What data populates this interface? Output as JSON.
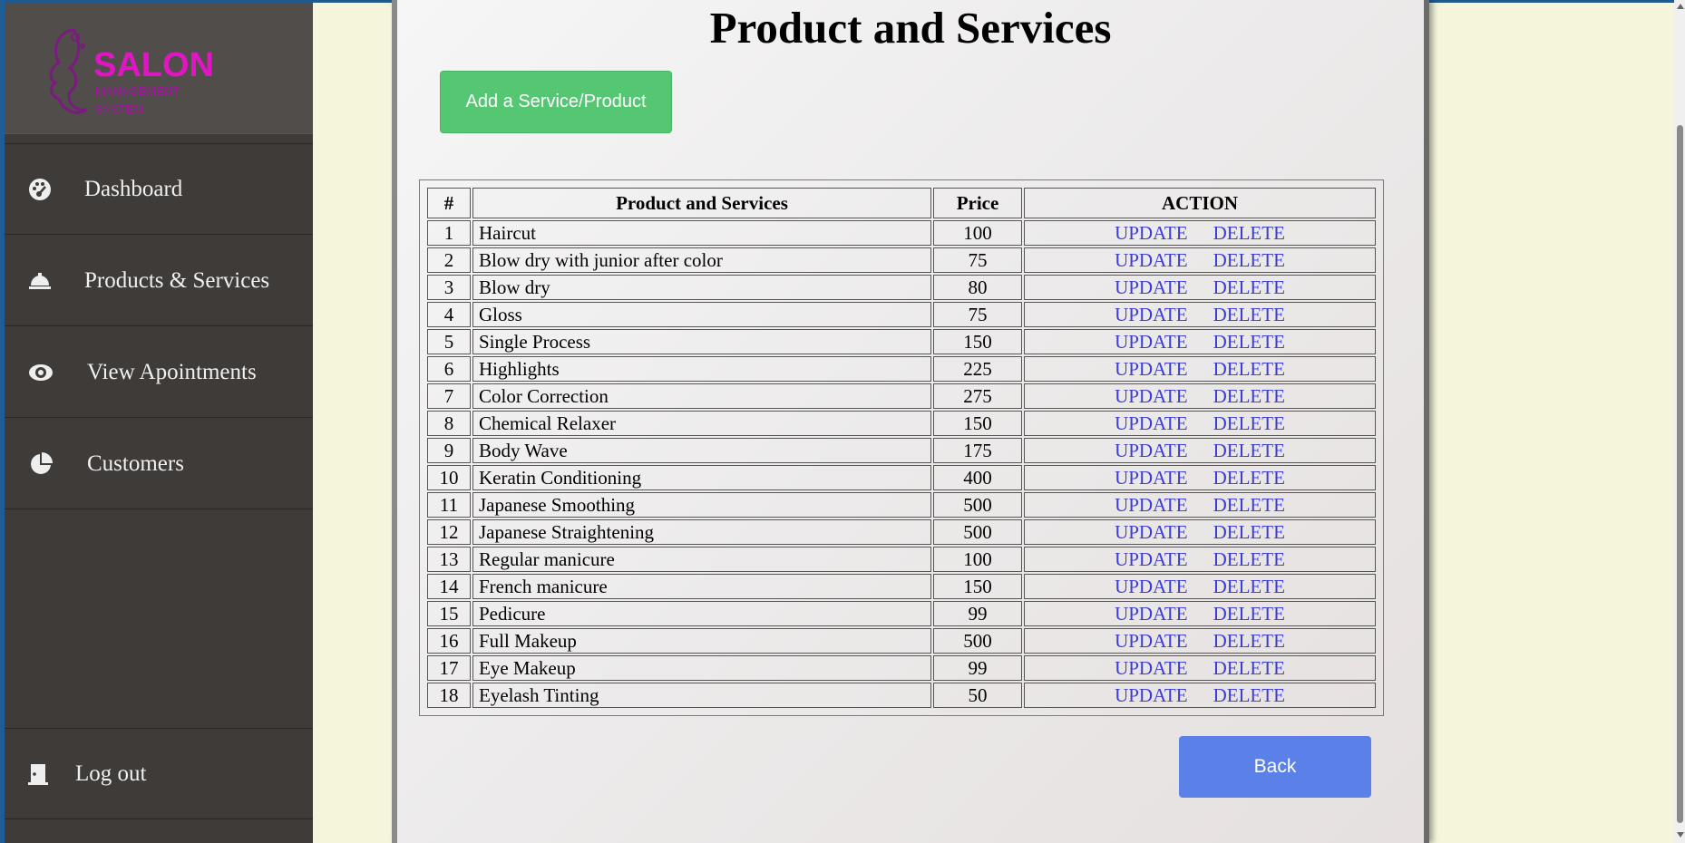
{
  "sidebar": {
    "logo": {
      "title": "SALON",
      "line1": "MANAGEMENT",
      "line2": "SYSTEM"
    },
    "items": [
      {
        "label": "Dashboard",
        "icon": "dashboard-icon"
      },
      {
        "label": "Products & Services",
        "icon": "bell-icon"
      },
      {
        "label": "View Apointments",
        "icon": "eye-icon"
      },
      {
        "label": "Customers",
        "icon": "pie-chart-icon"
      }
    ],
    "logout": {
      "label": "Log out",
      "icon": "door-icon"
    }
  },
  "main": {
    "title": "Product and Services",
    "add_button": "Add a Service/Product",
    "back_button": "Back",
    "table": {
      "headers": [
        "#",
        "Product and Services",
        "Price",
        "ACTION"
      ],
      "update_label": "UPDATE",
      "delete_label": "DELETE",
      "rows": [
        {
          "id": "1",
          "name": "Haircut",
          "price": "100"
        },
        {
          "id": "2",
          "name": "Blow dry with junior after color",
          "price": "75"
        },
        {
          "id": "3",
          "name": "Blow dry",
          "price": "80"
        },
        {
          "id": "4",
          "name": "Gloss",
          "price": "75"
        },
        {
          "id": "5",
          "name": "Single Process",
          "price": "150"
        },
        {
          "id": "6",
          "name": "Highlights",
          "price": "225"
        },
        {
          "id": "7",
          "name": "Color Correction",
          "price": "275"
        },
        {
          "id": "8",
          "name": "Chemical Relaxer",
          "price": "150"
        },
        {
          "id": "9",
          "name": "Body Wave",
          "price": "175"
        },
        {
          "id": "10",
          "name": "Keratin Conditioning",
          "price": "400"
        },
        {
          "id": "11",
          "name": "Japanese Smoothing",
          "price": "500"
        },
        {
          "id": "12",
          "name": "Japanese Straightening",
          "price": "500"
        },
        {
          "id": "13",
          "name": "Regular manicure",
          "price": "100"
        },
        {
          "id": "14",
          "name": "French manicure",
          "price": "150"
        },
        {
          "id": "15",
          "name": "Pedicure",
          "price": "99"
        },
        {
          "id": "16",
          "name": "Full Makeup",
          "price": "500"
        },
        {
          "id": "17",
          "name": "Eye Makeup",
          "price": "99"
        },
        {
          "id": "18",
          "name": "Eyelash Tinting",
          "price": "50"
        }
      ]
    }
  },
  "colors": {
    "sidebar_bg": "#3e3b39",
    "logo_pink": "#e215c5",
    "add_button": "#55c773",
    "back_button": "#5b80e8",
    "link_blue": "#3b3bd6",
    "page_bg": "#f5f5dc"
  }
}
